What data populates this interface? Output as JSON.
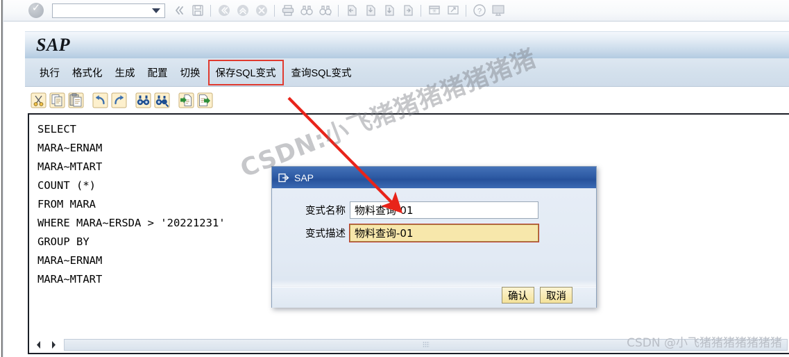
{
  "system_toolbar": {
    "ok_icon": "check-circle-icon",
    "command_field_value": "",
    "command_field_placeholder": "",
    "dropdown_icon": "chevron-down-icon",
    "buttons": [
      {
        "name": "enter-back-icon",
        "label": "«"
      },
      {
        "name": "save-icon",
        "label": "Save"
      },
      {
        "name": "back-icon",
        "label": "Back"
      },
      {
        "name": "exit-icon",
        "label": "Exit"
      },
      {
        "name": "cancel-icon",
        "label": "Cancel"
      },
      {
        "name": "print-icon",
        "label": "Print"
      },
      {
        "name": "find-icon",
        "label": "Find"
      },
      {
        "name": "find-next-icon",
        "label": "Find Next"
      },
      {
        "name": "first-page-icon",
        "label": "First Page"
      },
      {
        "name": "previous-page-icon",
        "label": "Previous Page"
      },
      {
        "name": "next-page-icon",
        "label": "Next Page"
      },
      {
        "name": "last-page-icon",
        "label": "Last Page"
      },
      {
        "name": "create-session-icon",
        "label": "Create Session"
      },
      {
        "name": "create-shortcut-icon",
        "label": "Create Shortcut"
      },
      {
        "name": "help-icon",
        "label": "Help"
      },
      {
        "name": "customize-layout-icon",
        "label": "Customize Local Layout"
      }
    ]
  },
  "window": {
    "title": "SAP",
    "menu": [
      {
        "label": "执行",
        "highlighted": false
      },
      {
        "label": "格式化",
        "highlighted": false
      },
      {
        "label": "生成",
        "highlighted": false
      },
      {
        "label": "配置",
        "highlighted": false
      },
      {
        "label": "切换",
        "highlighted": false
      },
      {
        "label": "保存SQL变式",
        "highlighted": true
      },
      {
        "label": "查询SQL变式",
        "highlighted": false
      }
    ]
  },
  "editor_toolbar": [
    {
      "name": "cut-icon",
      "label": "剪切"
    },
    {
      "name": "copy-icon",
      "label": "复制"
    },
    {
      "name": "paste-icon",
      "label": "粘贴"
    },
    {
      "name": "undo-icon",
      "label": "撤销"
    },
    {
      "name": "redo-icon",
      "label": "重做"
    },
    {
      "name": "find-icon",
      "label": "查找"
    },
    {
      "name": "find-replace-icon",
      "label": "查找替换"
    },
    {
      "name": "upload-icon",
      "label": "上载"
    },
    {
      "name": "download-icon",
      "label": "下载"
    }
  ],
  "editor": {
    "sql": "SELECT\nMARA~ERNAM\nMARA~MTART\nCOUNT (*)\nFROM MARA\nWHERE MARA~ERSDA > '20221231'\nGROUP BY\nMARA~ERNAM\nMARA~MTART",
    "scroll_left_icon": "triangle-left-icon",
    "scroll_right_icon": "triangle-right-icon"
  },
  "dialog": {
    "title": "SAP",
    "title_icon": "logoff-icon",
    "fields": [
      {
        "label": "变式名称",
        "value": "物料查询-01",
        "focused": false
      },
      {
        "label": "变式描述",
        "value": "物料查询-01",
        "focused": true
      }
    ],
    "buttons": [
      {
        "label": "确认",
        "name": "confirm-button"
      },
      {
        "label": "取消",
        "name": "cancel-button"
      }
    ]
  },
  "annotations": {
    "arrow_color": "#e8241a",
    "highlight_color": "#e03a2f"
  },
  "watermarks": {
    "diagonal": "CSDN:小飞猪猪猪猪猪猪猪",
    "corner": "CSDN @小飞猪猪猪猪猪猪猪"
  }
}
